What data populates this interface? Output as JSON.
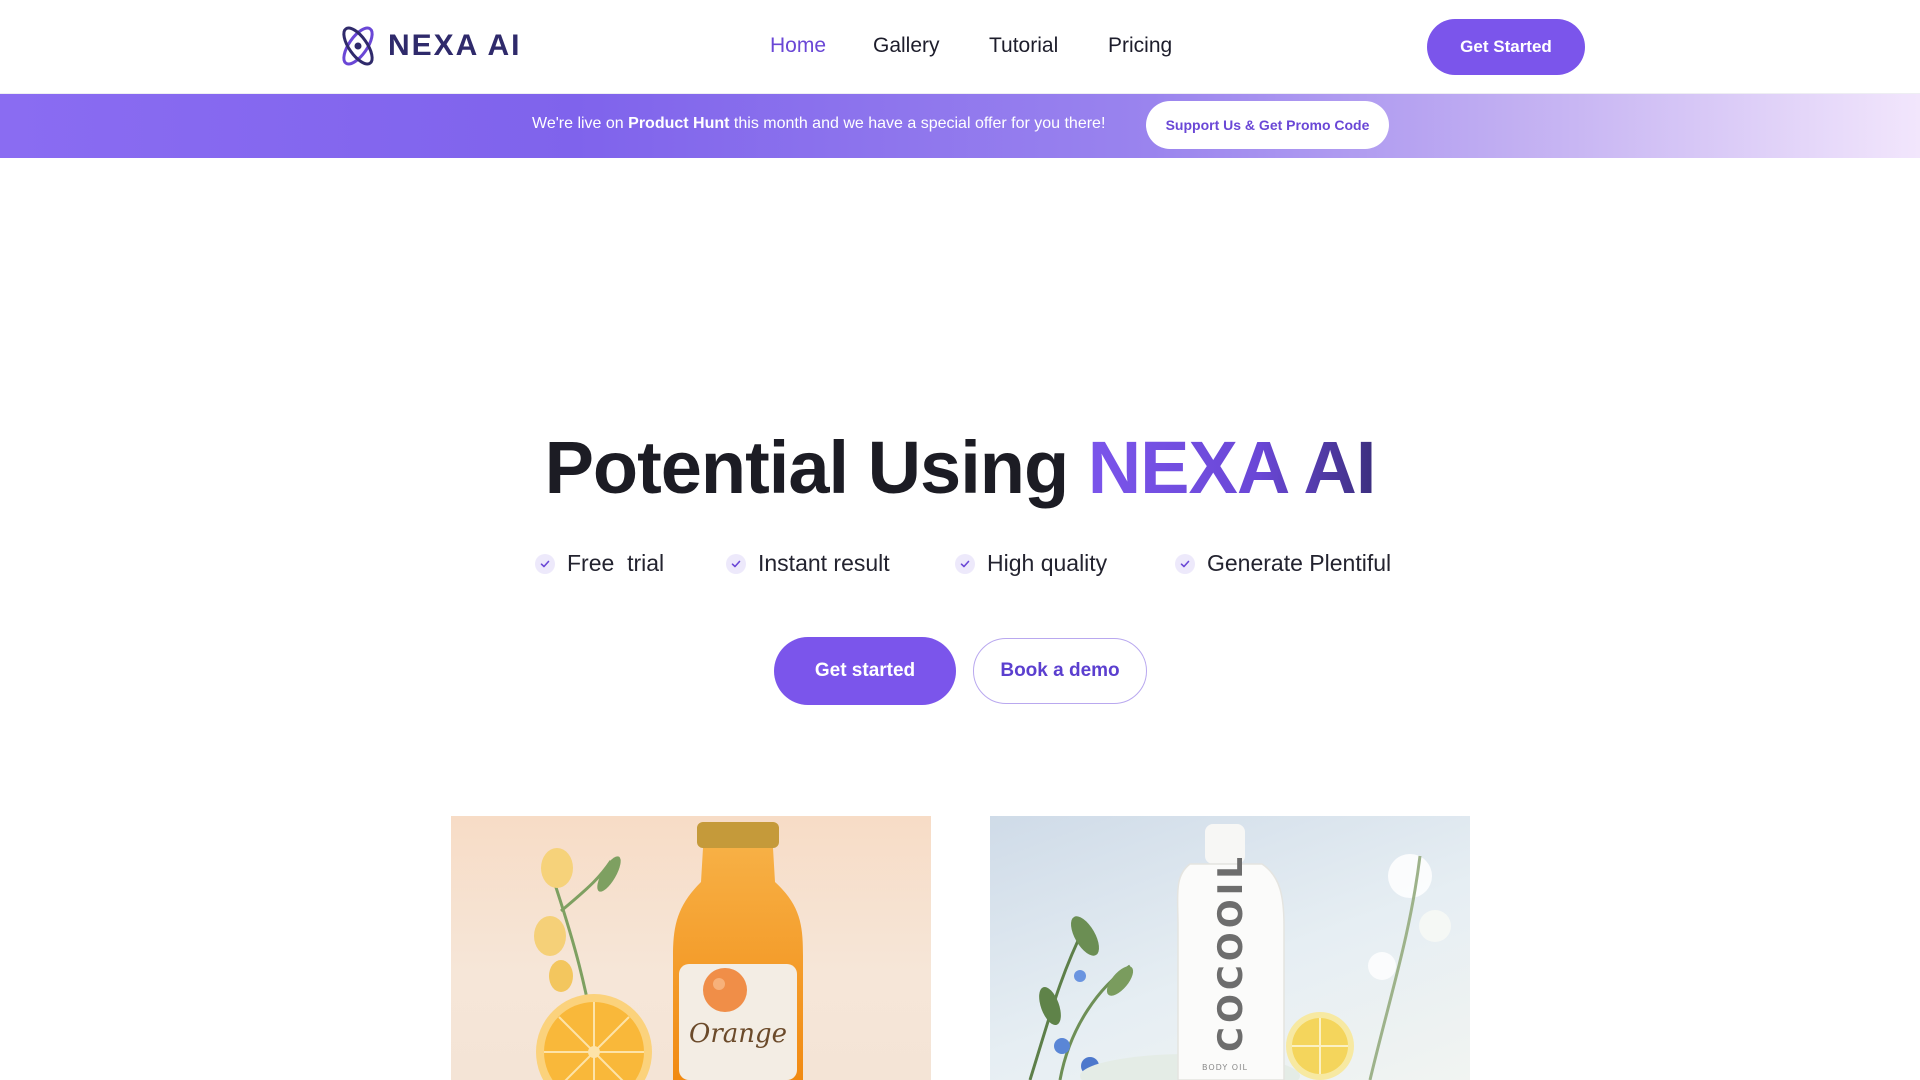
{
  "nav": {
    "logo_text": "NEXA AI",
    "links": [
      {
        "label": "Home",
        "active": true
      },
      {
        "label": "Gallery",
        "active": false
      },
      {
        "label": "Tutorial",
        "active": false
      },
      {
        "label": "Pricing",
        "active": false
      }
    ],
    "cta_label": "Get Started"
  },
  "promo": {
    "text_before": "We're live on ",
    "highlight": "Product Hunt",
    "text_after": " this month and we have a special offer for you there!",
    "button_label": "Support Us & Get Promo Code"
  },
  "hero": {
    "title_plain": "Potential Using ",
    "title_brand": "NEXA AI",
    "features": [
      "Free  trial",
      "Instant result",
      "High quality",
      "Generate Plentiful"
    ],
    "primary_button": "Get started",
    "secondary_button": "Book a demo"
  },
  "gallery": {
    "items": [
      {
        "bottle_label": "Orange"
      },
      {
        "bottle_label": "COCOOIL",
        "bottle_sublabel": "BODY OIL"
      }
    ]
  },
  "colors": {
    "accent": "#7b55eb",
    "accent_dark": "#6a47d6",
    "logo": "#2f2a6b",
    "text": "#1c1c24"
  }
}
